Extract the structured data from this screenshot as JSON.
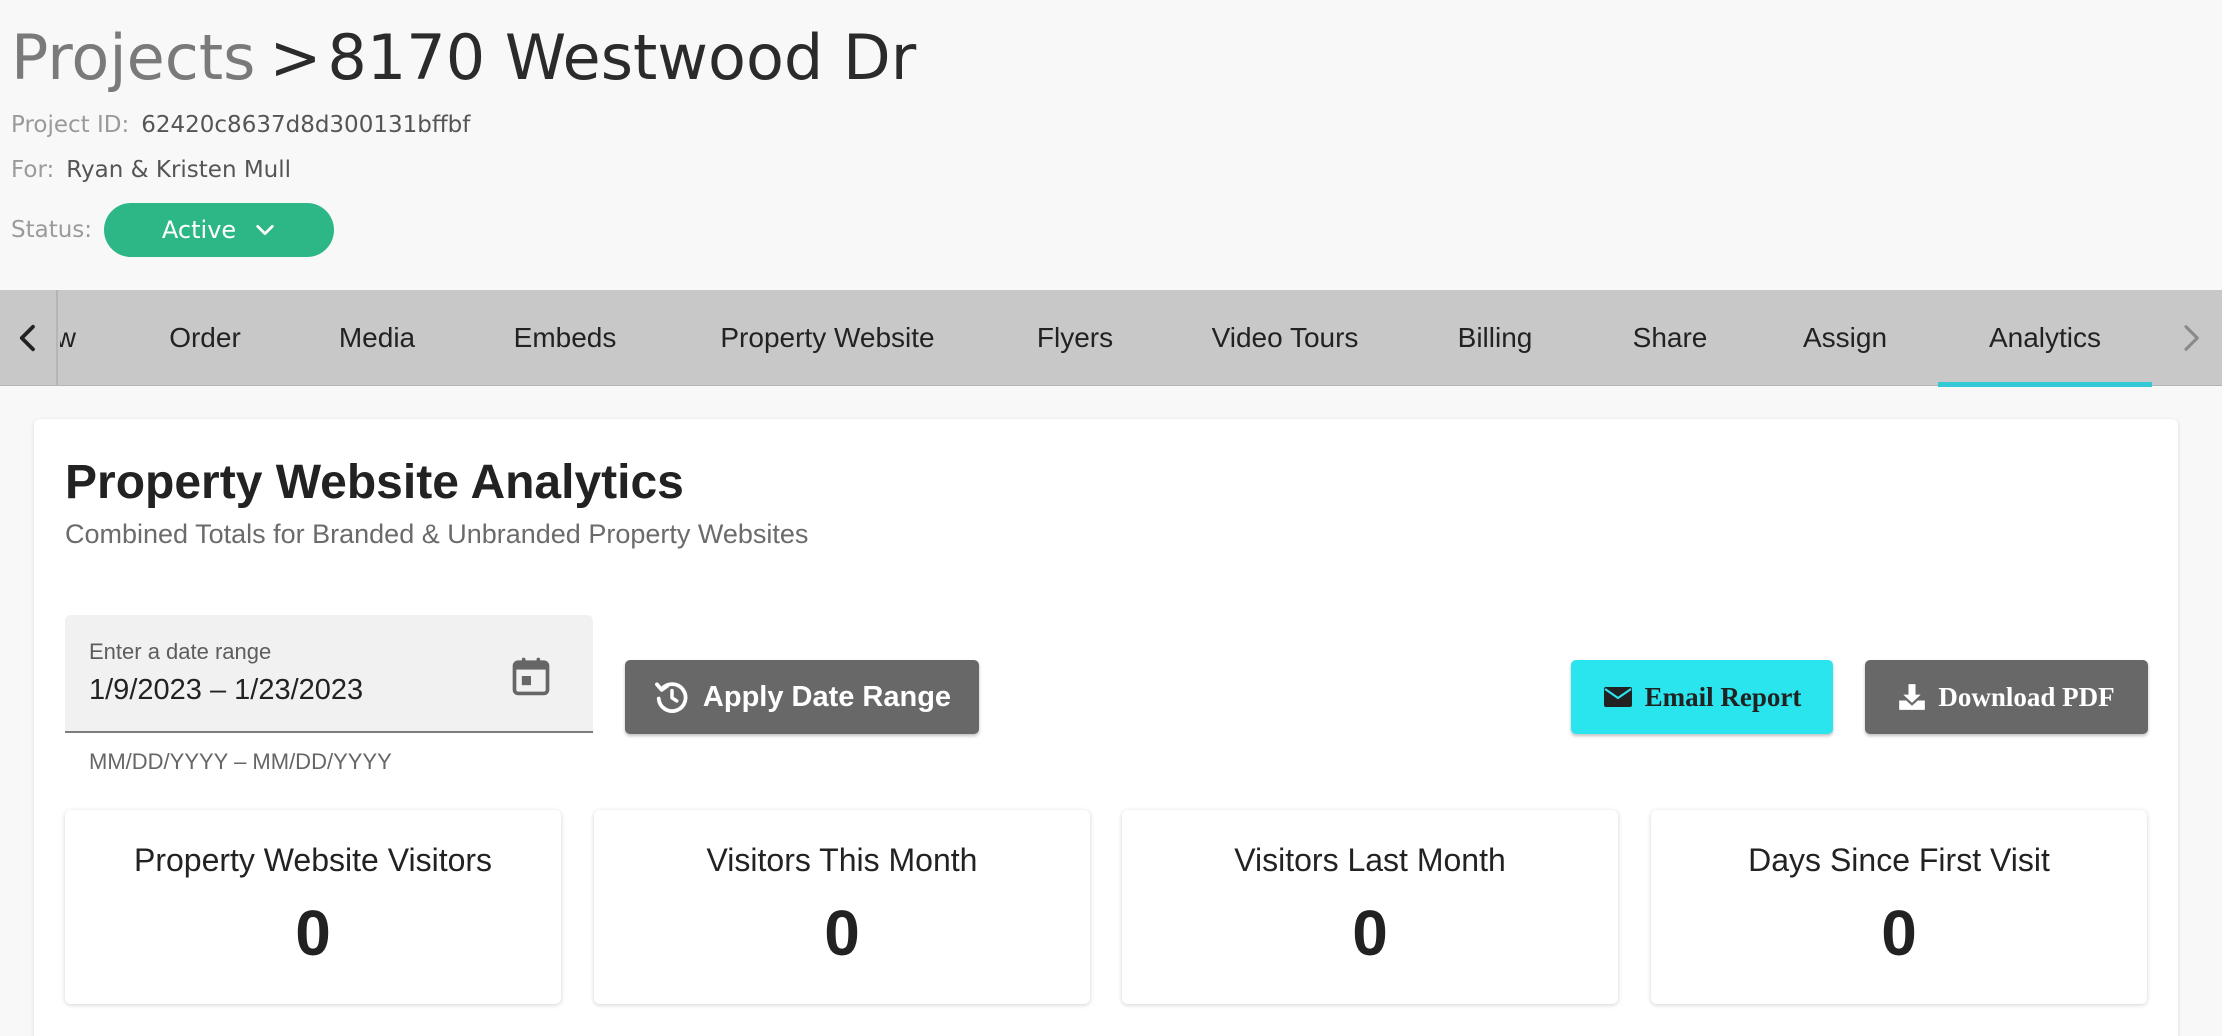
{
  "header": {
    "breadcrumb": {
      "root": "Projects",
      "separator": ">",
      "current": "8170 Westwood Dr"
    },
    "project_id": {
      "label": "Project ID:",
      "value": "62420c8637d8d300131bffbf"
    },
    "client": {
      "label": "For:",
      "value": "Ryan & Kristen Mull"
    },
    "status": {
      "label": "Status:",
      "value": "Active",
      "icon": "chevron-down-icon",
      "color": "#2db787"
    }
  },
  "tabs": {
    "prev_icon": "chevron-left-icon",
    "next_icon": "chevron-right-icon",
    "items": [
      {
        "label": "Overview",
        "partial_visible": "w"
      },
      {
        "label": "Order"
      },
      {
        "label": "Media"
      },
      {
        "label": "Embeds"
      },
      {
        "label": "Property Website"
      },
      {
        "label": "Flyers"
      },
      {
        "label": "Video Tours"
      },
      {
        "label": "Billing"
      },
      {
        "label": "Share"
      },
      {
        "label": "Assign"
      },
      {
        "label": "Analytics",
        "active": true
      }
    ],
    "active_indicator_color": "#33c9d6"
  },
  "analytics": {
    "title": "Property Website Analytics",
    "subtitle": "Combined Totals for Branded & Unbranded Property Websites",
    "date_range": {
      "label": "Enter a date range",
      "value": "1/9/2023 – 1/23/2023",
      "hint": "MM/DD/YYYY – MM/DD/YYYY",
      "icon": "calendar-icon"
    },
    "apply_button": {
      "label": "Apply Date Range",
      "icon": "refresh-clock-icon"
    },
    "email_button": {
      "label": "Email Report",
      "icon": "envelope-icon",
      "color": "#2ae5ee"
    },
    "pdf_button": {
      "label": "Download PDF",
      "icon": "download-icon"
    },
    "stats": [
      {
        "label": "Property Website Visitors",
        "value": "0"
      },
      {
        "label": "Visitors This Month",
        "value": "0"
      },
      {
        "label": "Visitors Last Month",
        "value": "0"
      },
      {
        "label": "Days Since First Visit",
        "value": "0"
      }
    ]
  }
}
